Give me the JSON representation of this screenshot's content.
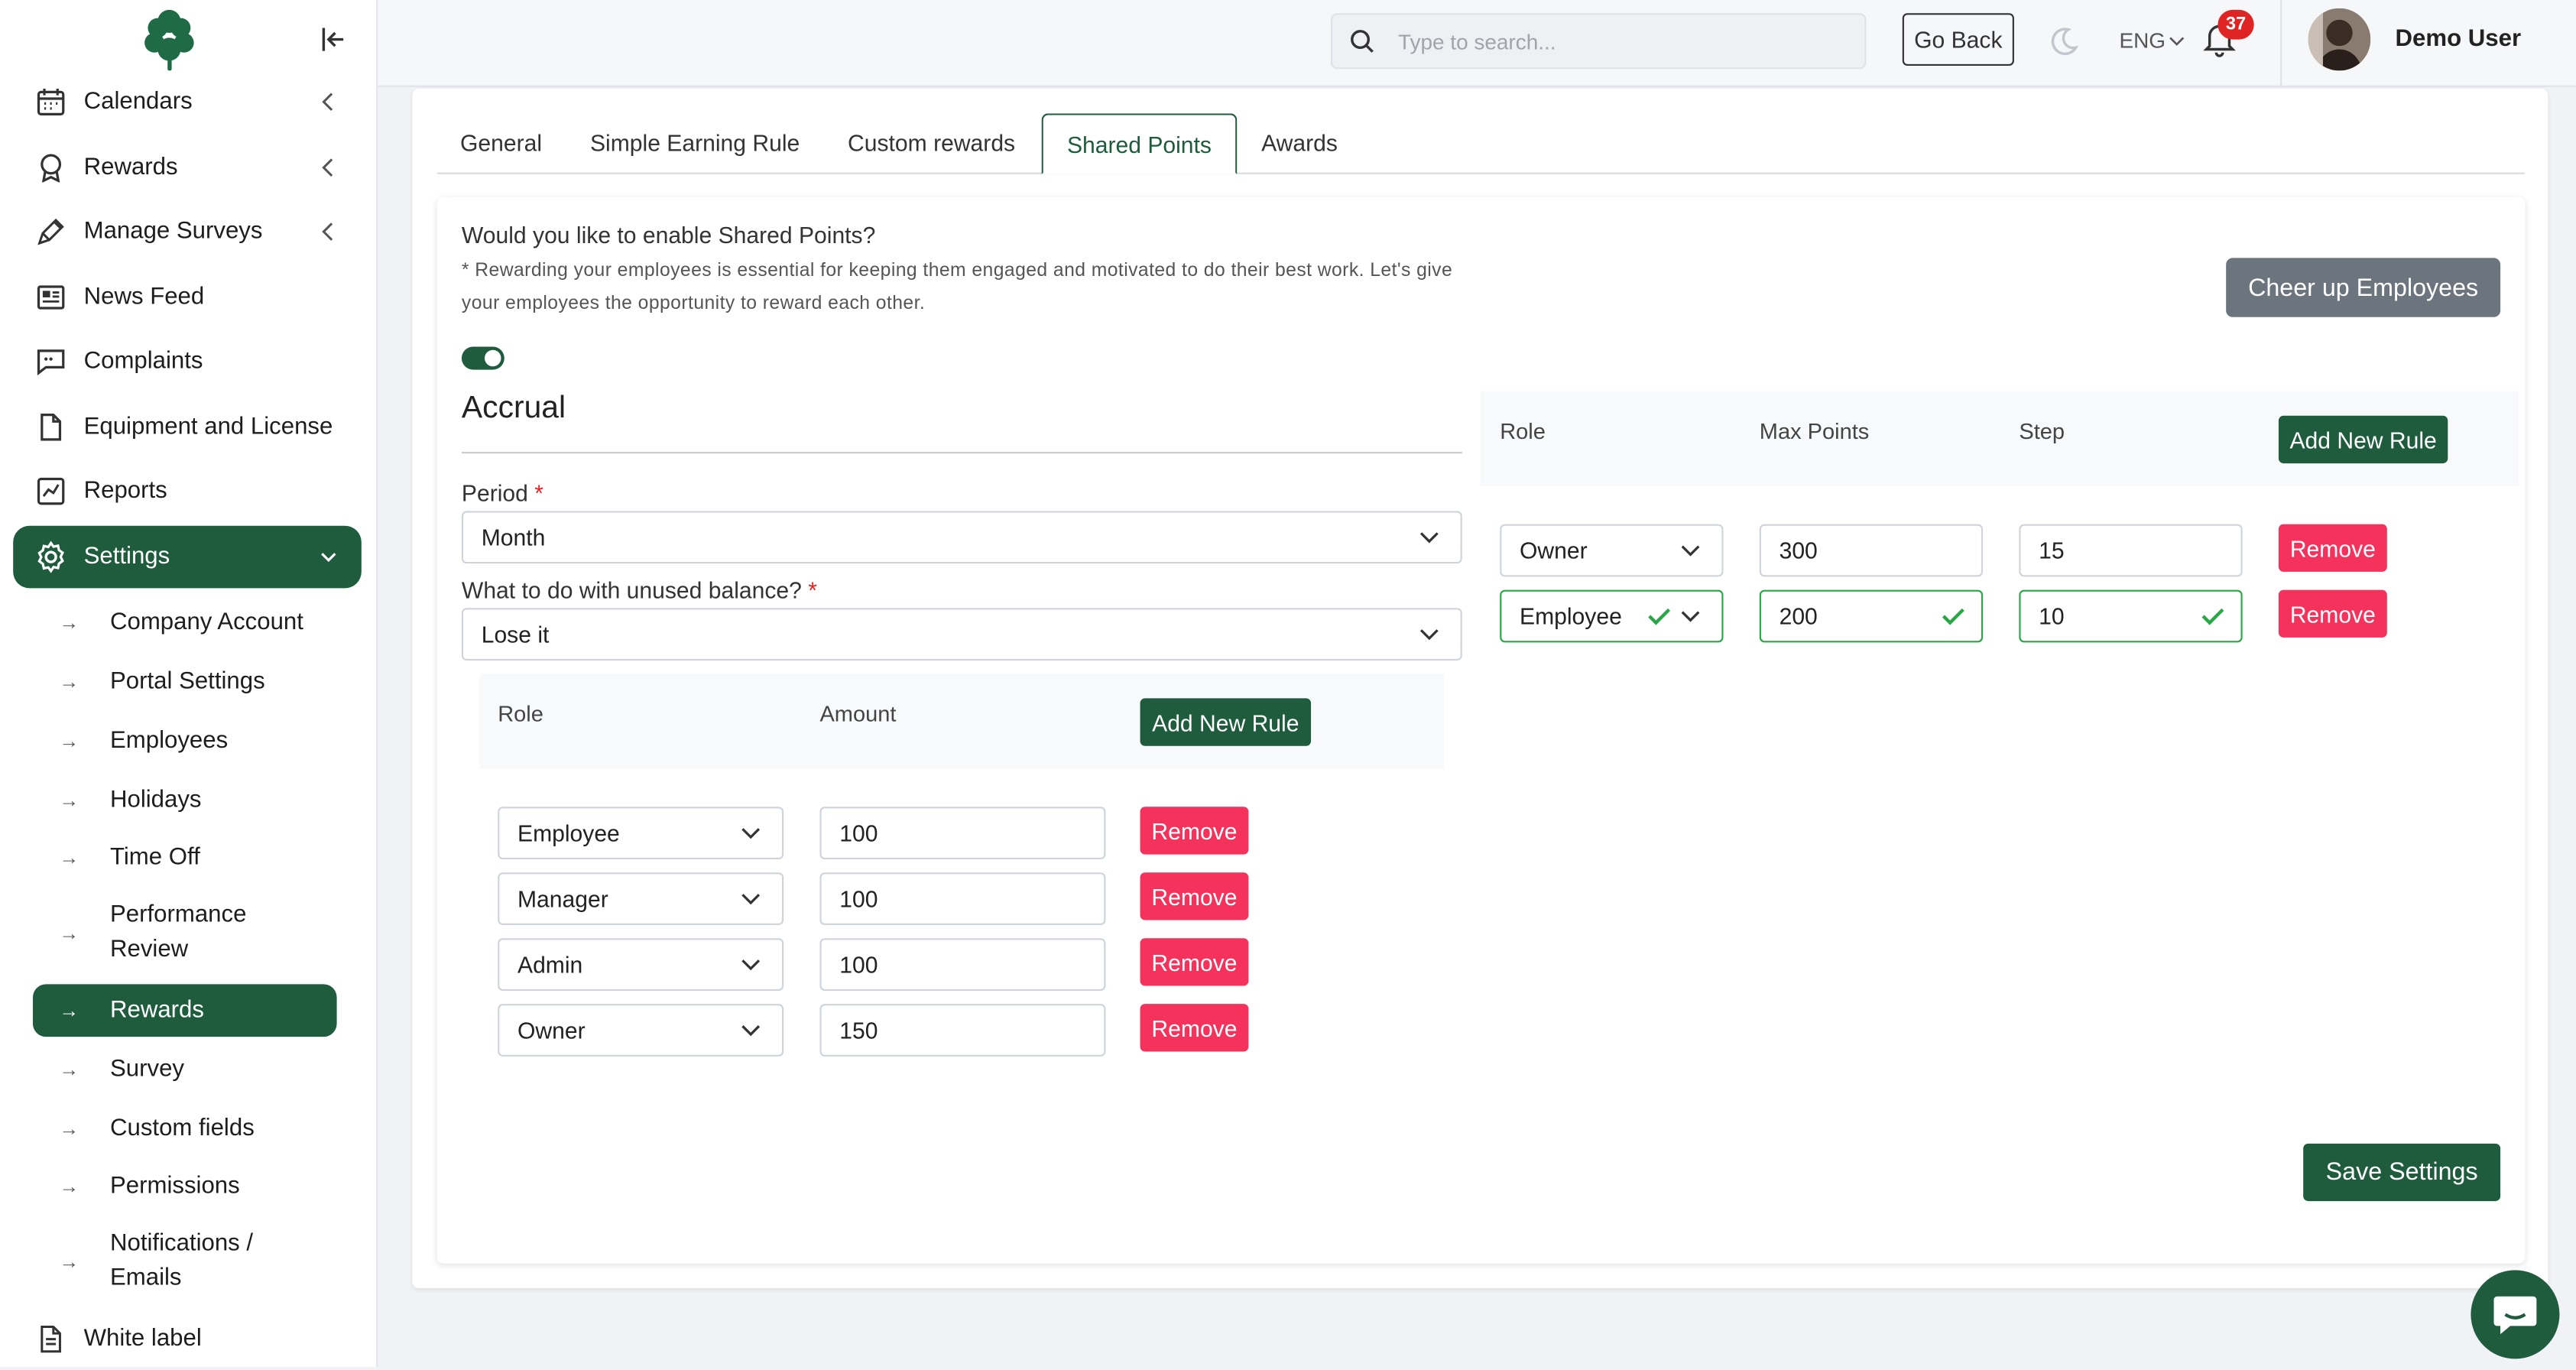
{
  "sidebar": {
    "items": [
      {
        "label": "Calendars",
        "icon": "calendar-icon"
      },
      {
        "label": "Rewards",
        "icon": "award-icon"
      },
      {
        "label": "Manage Surveys",
        "icon": "pen-icon"
      },
      {
        "label": "News Feed",
        "icon": "newspaper-icon"
      },
      {
        "label": "Complaints",
        "icon": "chat-icon"
      },
      {
        "label": "Equipment and License",
        "icon": "file-icon"
      },
      {
        "label": "Reports",
        "icon": "chart-icon"
      },
      {
        "label": "Settings",
        "icon": "gear-icon"
      }
    ],
    "sub_items": [
      "Company Account",
      "Portal Settings",
      "Employees",
      "Holidays",
      "Time Off",
      "Performance Review",
      "Rewards",
      "Survey",
      "Custom fields",
      "Permissions",
      "Notifications / Emails"
    ],
    "bottom_item": {
      "label": "White label",
      "icon": "document-icon"
    }
  },
  "header": {
    "search_placeholder": "Type to search...",
    "go_back": "Go Back",
    "language": "ENG",
    "notification_count": "37",
    "user_name": "Demo User"
  },
  "tabs": [
    "General",
    "Simple Earning Rule",
    "Custom rewards",
    "Shared Points",
    "Awards"
  ],
  "content": {
    "question": "Would you like to enable Shared Points?",
    "note": "* Rewarding your employees is essential for keeping them engaged and motivated to do their best work. Let's give your employees the opportunity to reward each other.",
    "cheer_button": "Cheer up Employees",
    "accrual_title": "Accrual",
    "period_label": "Period",
    "period_value": "Month",
    "unused_label": "What to do with unused balance?",
    "unused_value": "Lose it",
    "required_mark": "*",
    "save_button": "Save Settings"
  },
  "accrual_table": {
    "col_role": "Role",
    "col_amount": "Amount",
    "add_button": "Add New Rule",
    "remove_label": "Remove",
    "rows": [
      {
        "role": "Employee",
        "amount": "100"
      },
      {
        "role": "Manager",
        "amount": "100"
      },
      {
        "role": "Admin",
        "amount": "100"
      },
      {
        "role": "Owner",
        "amount": "150"
      }
    ]
  },
  "points_table": {
    "col_role": "Role",
    "col_max": "Max Points",
    "col_step": "Step",
    "add_button": "Add New Rule",
    "remove_label": "Remove",
    "rows": [
      {
        "role": "Owner",
        "max": "300",
        "step": "15",
        "valid": false
      },
      {
        "role": "Employee",
        "max": "200",
        "step": "10",
        "valid": true
      }
    ]
  },
  "colors": {
    "primary": "#1f5c3e",
    "danger": "#f5325c",
    "secondary": "#6c757d",
    "valid": "#28a745"
  }
}
